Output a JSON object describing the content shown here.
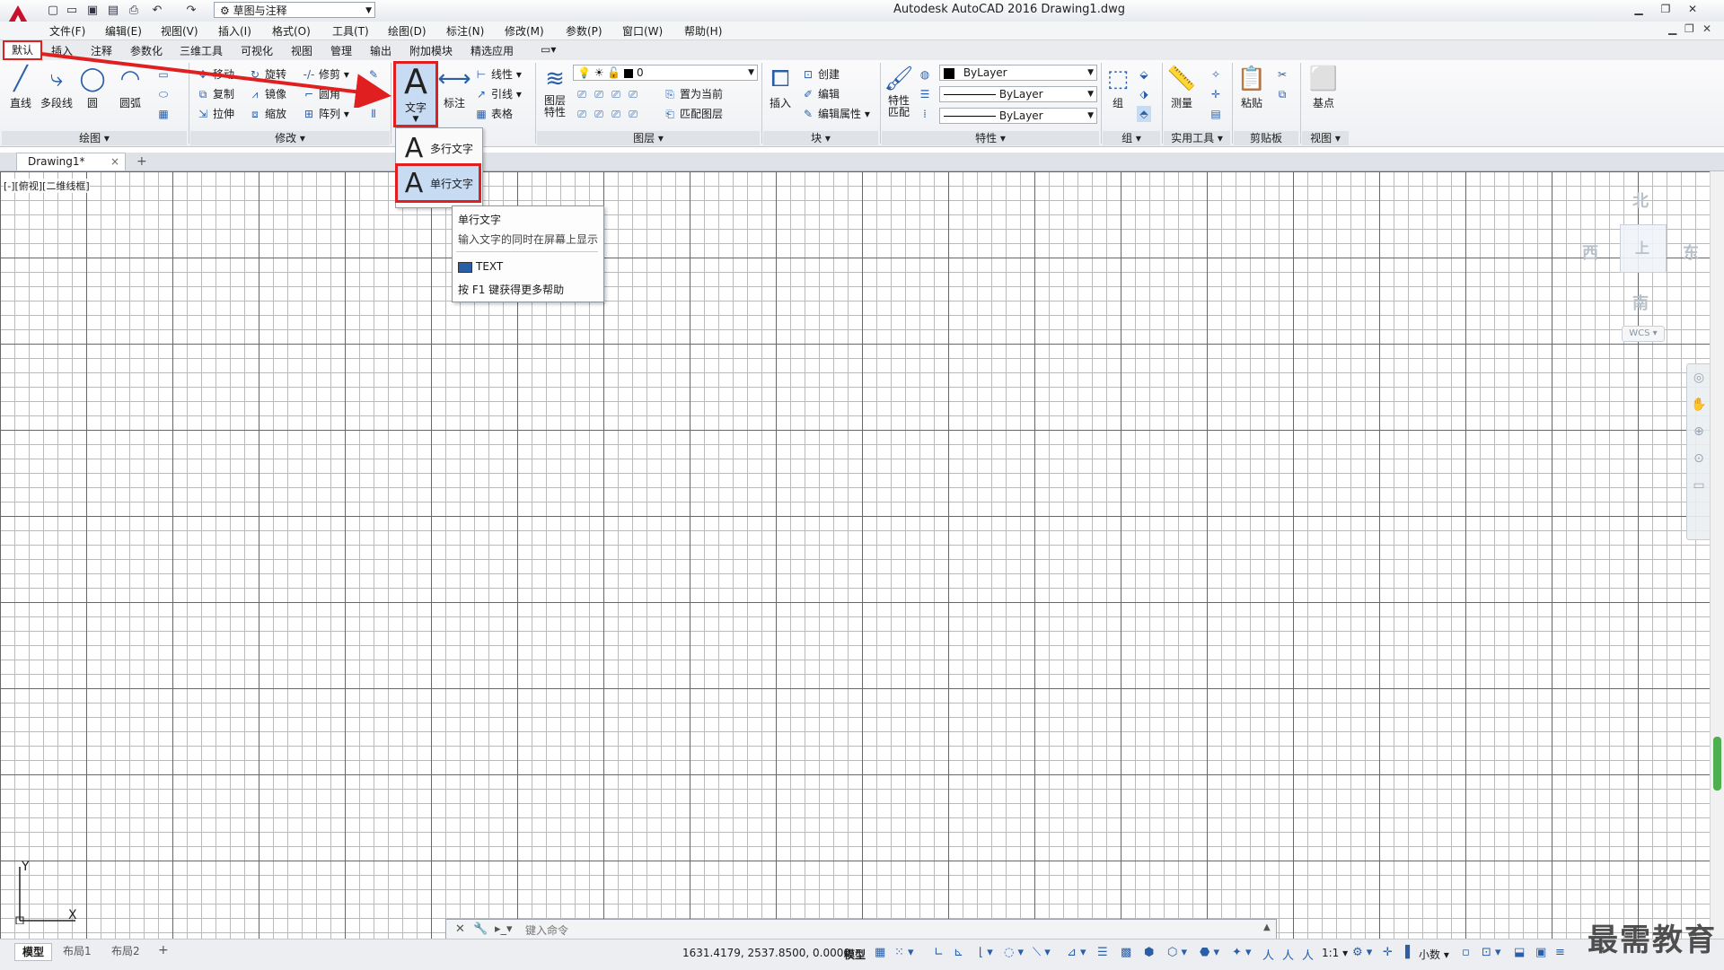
{
  "app": {
    "title": "Autodesk AutoCAD 2016    Drawing1.dwg",
    "workspace": "草图与注释",
    "colors": {
      "accent": "#2a5fa8",
      "highlight": "#e02020",
      "logo": "#c8102e"
    }
  },
  "menubar": [
    "文件(F)",
    "编辑(E)",
    "视图(V)",
    "插入(I)",
    "格式(O)",
    "工具(T)",
    "绘图(D)",
    "标注(N)",
    "修改(M)",
    "参数(P)",
    "窗口(W)",
    "帮助(H)"
  ],
  "ribbon_tabs": [
    "默认",
    "插入",
    "注释",
    "参数化",
    "三维工具",
    "可视化",
    "视图",
    "管理",
    "输出",
    "附加模块",
    "精选应用"
  ],
  "panels": {
    "draw": {
      "title": "绘图",
      "line": "直线",
      "polyline": "多段线",
      "circle": "圆",
      "arc": "圆弧"
    },
    "modify": {
      "title": "修改",
      "move": "移动",
      "rotate": "旋转",
      "trim": "修剪",
      "copy": "复制",
      "mirror": "镜像",
      "fillet": "圆角",
      "stretch": "拉伸",
      "scale": "缩放",
      "array": "阵列"
    },
    "annotation": {
      "text": "文字",
      "dimension": "标注",
      "linear": "线性",
      "leader": "引线",
      "table": "表格"
    },
    "layers": {
      "title": "图层",
      "layer_props": "图层\n特性",
      "current_layer": "0",
      "set_current": "置为当前",
      "match_layer": "匹配图层"
    },
    "block": {
      "title": "块",
      "insert": "插入",
      "create": "创建",
      "edit": "编辑",
      "edit_attr": "编辑属性"
    },
    "properties": {
      "title": "特性",
      "match": "特性\n匹配",
      "color": "ByLayer",
      "linetype": "ByLayer",
      "lineweight": "ByLayer"
    },
    "groups": {
      "title": "组",
      "group": "组"
    },
    "utilities": {
      "title": "实用工具",
      "measure": "测量"
    },
    "clipboard": {
      "title": "剪贴板",
      "paste": "粘贴"
    },
    "view": {
      "title": "视图",
      "base": "基点"
    }
  },
  "text_dropdown": {
    "multiline": "多行文字",
    "single": "单行文字"
  },
  "tooltip": {
    "title": "单行文字",
    "desc": "输入文字的同时在屏幕上显示",
    "command": "TEXT",
    "help": "按 F1 键获得更多帮助"
  },
  "document_tab": "Drawing1*",
  "viewport_label": "[-][俯视][二维线框]",
  "viewcube": {
    "north": "北",
    "south": "南",
    "east": "东",
    "west": "西",
    "top": "上",
    "wcs": "WCS"
  },
  "command_line": {
    "placeholder": "键入命令"
  },
  "layout_tabs": [
    "模型",
    "布局1",
    "布局2"
  ],
  "status": {
    "coords": "1631.4179, 2537.8500, 0.0000",
    "model": "模型",
    "scale": "1:1",
    "units": "小数"
  },
  "ucs": {
    "x": "X",
    "y": "Y"
  },
  "watermark": "最需教育"
}
